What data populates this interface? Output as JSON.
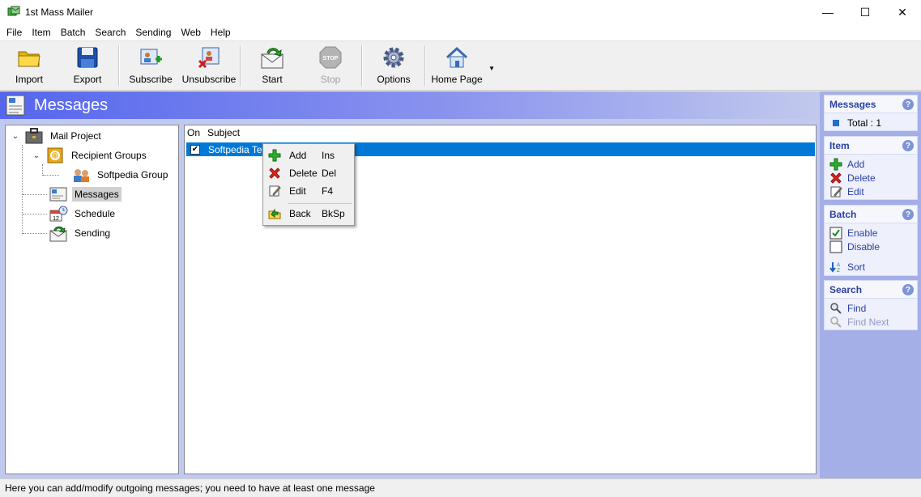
{
  "window": {
    "title": "1st Mass Mailer",
    "controls": {
      "minimize": "—",
      "maximize": "☐",
      "close": "✕"
    }
  },
  "menu": [
    "File",
    "Item",
    "Batch",
    "Search",
    "Sending",
    "Web",
    "Help"
  ],
  "toolbar": {
    "import": "Import",
    "export": "Export",
    "subscribe": "Subscribe",
    "unsubscribe": "Unsubscribe",
    "start": "Start",
    "stop": "Stop",
    "options": "Options",
    "home_page": "Home Page"
  },
  "panel": {
    "title": "Messages"
  },
  "tree": {
    "root": "Mail Project",
    "recipient_groups": "Recipient Groups",
    "softpedia_group": "Softpedia Group",
    "messages": "Messages",
    "schedule": "Schedule",
    "sending": "Sending"
  },
  "list": {
    "col_on": "On",
    "col_subject": "Subject",
    "rows": [
      {
        "checked": true,
        "subject": "Softpedia Test"
      }
    ]
  },
  "context_menu": {
    "add": {
      "label": "Add",
      "shortcut": "Ins"
    },
    "delete": {
      "label": "Delete",
      "shortcut": "Del"
    },
    "edit": {
      "label": "Edit",
      "shortcut": "F4"
    },
    "back": {
      "label": "Back",
      "shortcut": "BkSp"
    }
  },
  "sidebar": {
    "messages": {
      "title": "Messages",
      "total": "Total : 1"
    },
    "item": {
      "title": "Item",
      "add": "Add",
      "delete": "Delete",
      "edit": "Edit"
    },
    "batch": {
      "title": "Batch",
      "enable": "Enable",
      "disable": "Disable",
      "sort": "Sort"
    },
    "search": {
      "title": "Search",
      "find": "Find",
      "find_next": "Find Next"
    },
    "help_glyph": "?"
  },
  "status": "Here you can add/modify outgoing messages; you need to have at least one message",
  "colors": {
    "header_gradient_start": "#5566ee",
    "selection": "#0078d7",
    "sidebar_bg": "#a4afe8",
    "sidebar_link": "#2a3fa5"
  }
}
